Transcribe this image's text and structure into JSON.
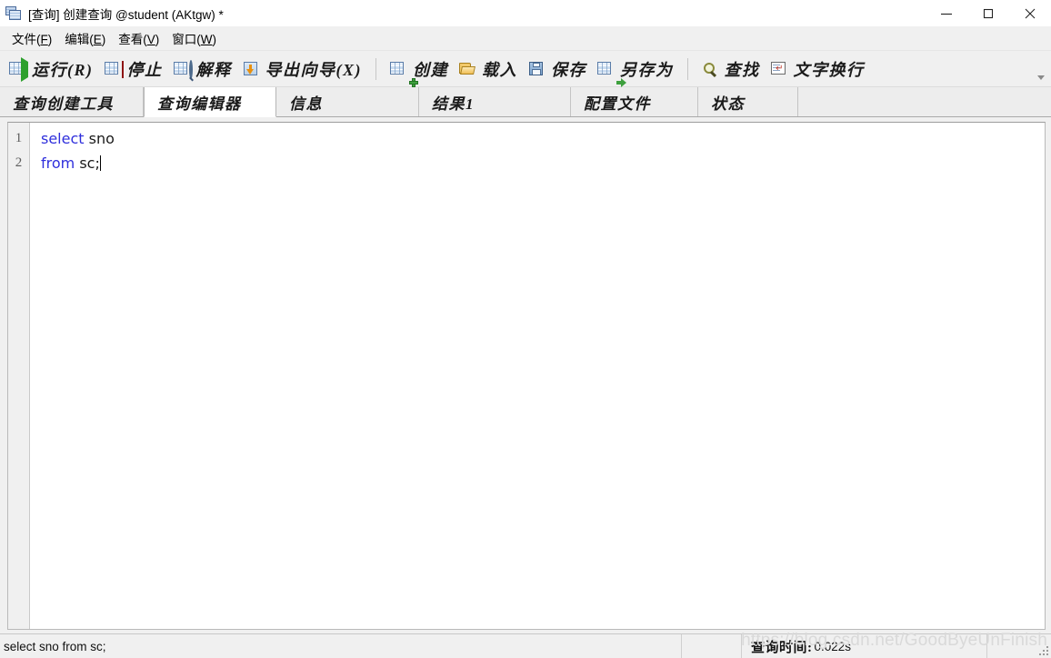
{
  "window": {
    "title": "[查询] 创建查询 @student (AKtgw) *",
    "icon": "query-window-icon",
    "controls": {
      "minimize": "minimize-icon",
      "maximize": "maximize-icon",
      "close": "close-icon"
    }
  },
  "menu": {
    "items": [
      {
        "label": "文件",
        "accel": "F"
      },
      {
        "label": "编辑",
        "accel": "E"
      },
      {
        "label": "查看",
        "accel": "V"
      },
      {
        "label": "窗口",
        "accel": "W"
      }
    ]
  },
  "toolbar": {
    "groups": [
      {
        "buttons": [
          {
            "label": "运行(R)",
            "icon": "run-icon"
          },
          {
            "label": "停止",
            "icon": "stop-icon"
          },
          {
            "label": "解释",
            "icon": "explain-icon"
          },
          {
            "label": "导出向导(X)",
            "icon": "export-wizard-icon"
          }
        ]
      },
      {
        "buttons": [
          {
            "label": "创建",
            "icon": "new-query-icon"
          },
          {
            "label": "载入",
            "icon": "load-icon"
          },
          {
            "label": "保存",
            "icon": "save-icon"
          },
          {
            "label": "另存为",
            "icon": "save-as-icon"
          }
        ]
      },
      {
        "buttons": [
          {
            "label": "查找",
            "icon": "find-icon"
          },
          {
            "label": "文字换行",
            "icon": "word-wrap-icon"
          }
        ]
      }
    ],
    "overflow_icon": "chevron-down-icon"
  },
  "tabs": [
    {
      "label": "查询创建工具",
      "active": false
    },
    {
      "label": "查询编辑器",
      "active": true
    },
    {
      "label": "信息",
      "active": false
    },
    {
      "label": "结果1",
      "active": false
    },
    {
      "label": "配置文件",
      "active": false
    },
    {
      "label": "状态",
      "active": false
    }
  ],
  "editor": {
    "lines": [
      {
        "number": "1",
        "tokens": [
          {
            "text": "select",
            "type": "kw"
          },
          {
            "text": " sno",
            "type": "id"
          }
        ]
      },
      {
        "number": "2",
        "tokens": [
          {
            "text": "from",
            "type": "kw"
          },
          {
            "text": " sc;",
            "type": "id"
          }
        ]
      }
    ],
    "line_numbers": [
      "1",
      "2"
    ],
    "line1_keyword": "select",
    "line1_rest": " sno",
    "line2_keyword": "from",
    "line2_rest": " sc;",
    "keyword_color": "#2f2fdc",
    "text_color": "#1a1a1a",
    "background": "#ffffff"
  },
  "statusbar": {
    "sql_text": "select sno from sc;",
    "query_time_label": "查询时间:",
    "query_time_value": "0.022s"
  },
  "watermark": {
    "text": "https://blog.csdn.net/GoodByeUnFinish"
  }
}
